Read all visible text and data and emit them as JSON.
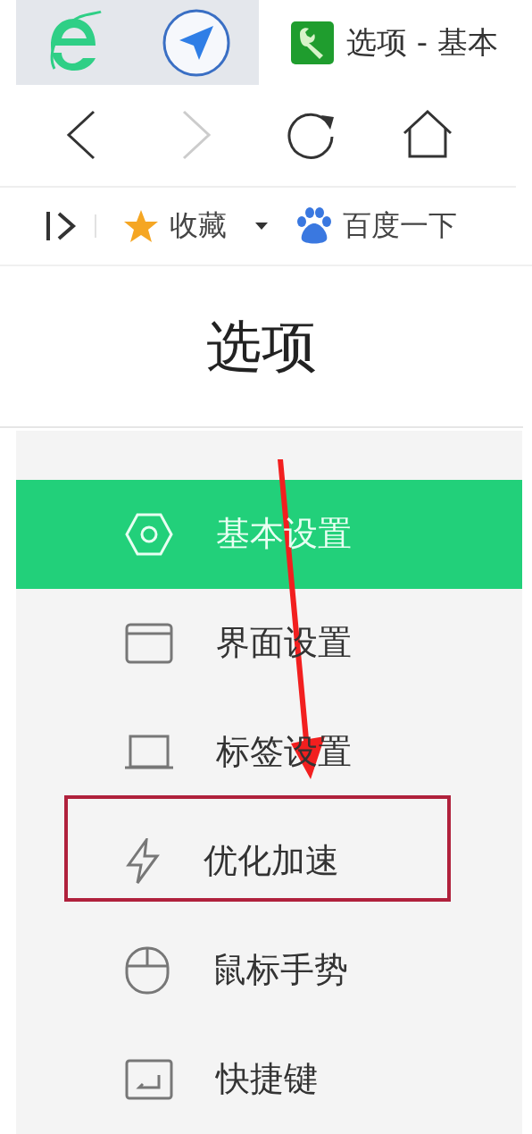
{
  "tab": {
    "title": "选项 - 基本"
  },
  "navigation": {
    "back_disabled": false,
    "forward_disabled": true
  },
  "bookmarks": [
    {
      "label": "收藏",
      "dropdown": true
    },
    {
      "label": "百度一下",
      "dropdown": false
    }
  ],
  "page_title": "选项",
  "sidebar": {
    "items": [
      {
        "label": "基本设置",
        "selected": true,
        "highlighted": false
      },
      {
        "label": "界面设置",
        "selected": false,
        "highlighted": false
      },
      {
        "label": "标签设置",
        "selected": false,
        "highlighted": false
      },
      {
        "label": "优化加速",
        "selected": false,
        "highlighted": true
      },
      {
        "label": "鼠标手势",
        "selected": false,
        "highlighted": false
      },
      {
        "label": "快捷键",
        "selected": false,
        "highlighted": false
      }
    ]
  }
}
